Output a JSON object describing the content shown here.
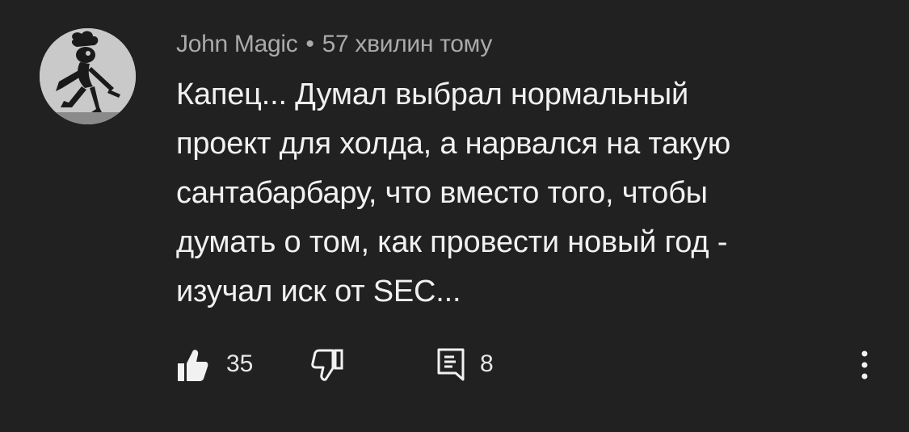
{
  "comment": {
    "author": "John Magic",
    "separator": "•",
    "time": "57 хвилин тому",
    "lines": [
      "Капец... Думал выбрал нормальный",
      "проект для холда, а нарвался на такую",
      "сантабарбару, что вместо того, чтобы",
      "думать о том, как провести новый год -",
      "изучал иск от SEC..."
    ],
    "likes": "35",
    "replies": "8"
  },
  "icons": {
    "like": "thumbs-up-icon",
    "dislike": "thumbs-down-icon",
    "reply": "comment-icon",
    "more": "more-vertical-icon",
    "avatar": "cartoon-chef-avatar"
  },
  "colors": {
    "background": "#212121",
    "text": "#f1f1f1",
    "meta": "#aaaaaa"
  }
}
